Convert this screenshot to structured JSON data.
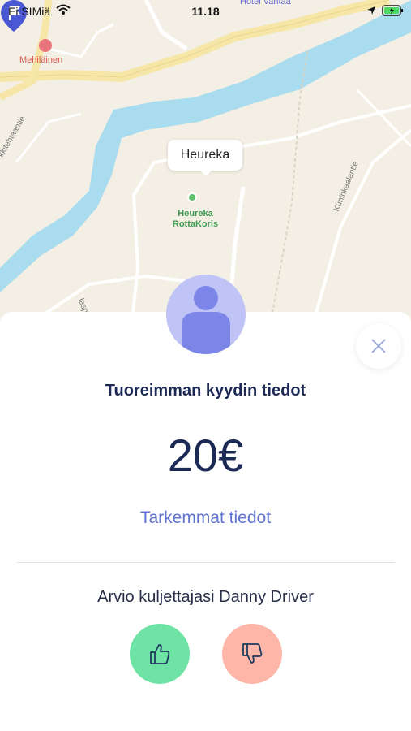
{
  "status_bar": {
    "carrier": "Ei SIMiä",
    "time": "11.18"
  },
  "map": {
    "callout": "Heureka",
    "poi_heureka": "Heureka\nRottaKoris",
    "poi_mehilainen": "Mehiläinen",
    "hotel": "Hotel Vantaa",
    "street_1": "kkitehtaantie",
    "street_2": "Kuninkaalantie",
    "street_3": "lespolku"
  },
  "sheet": {
    "title": "Tuoreimman kyydin tiedot",
    "price": "20€",
    "details_link": "Tarkemmat tiedot",
    "rating_label": "Arvio kuljettajasi Danny Driver"
  },
  "colors": {
    "accent": "#5f73d1",
    "positive": "#6fe3a6",
    "negative": "#fdb6a8",
    "avatar": "#bfc3f6"
  }
}
